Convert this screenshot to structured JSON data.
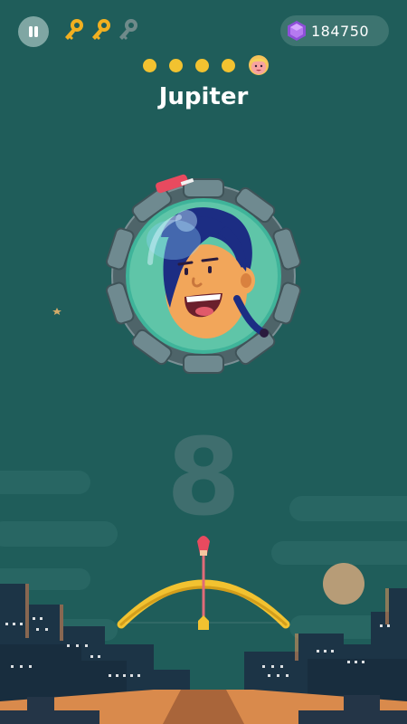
{
  "hud": {
    "pause_icon": "pause-icon",
    "keys": [
      {
        "icon": "key-icon",
        "collected": true
      },
      {
        "icon": "key-icon",
        "collected": true
      },
      {
        "icon": "key-icon",
        "collected": false
      }
    ],
    "gems": {
      "icon": "purple-gem-icon",
      "value": "184750"
    }
  },
  "progress": {
    "completed_dots": 4,
    "boss_icon": "boss-face-icon"
  },
  "level": {
    "title": "Jupiter",
    "countdown": "8"
  },
  "colors": {
    "background": "#1f5d5a",
    "gold": "#f2c230",
    "gem_purple": "#8e4fd8",
    "countdown": "#3f6e6e"
  }
}
